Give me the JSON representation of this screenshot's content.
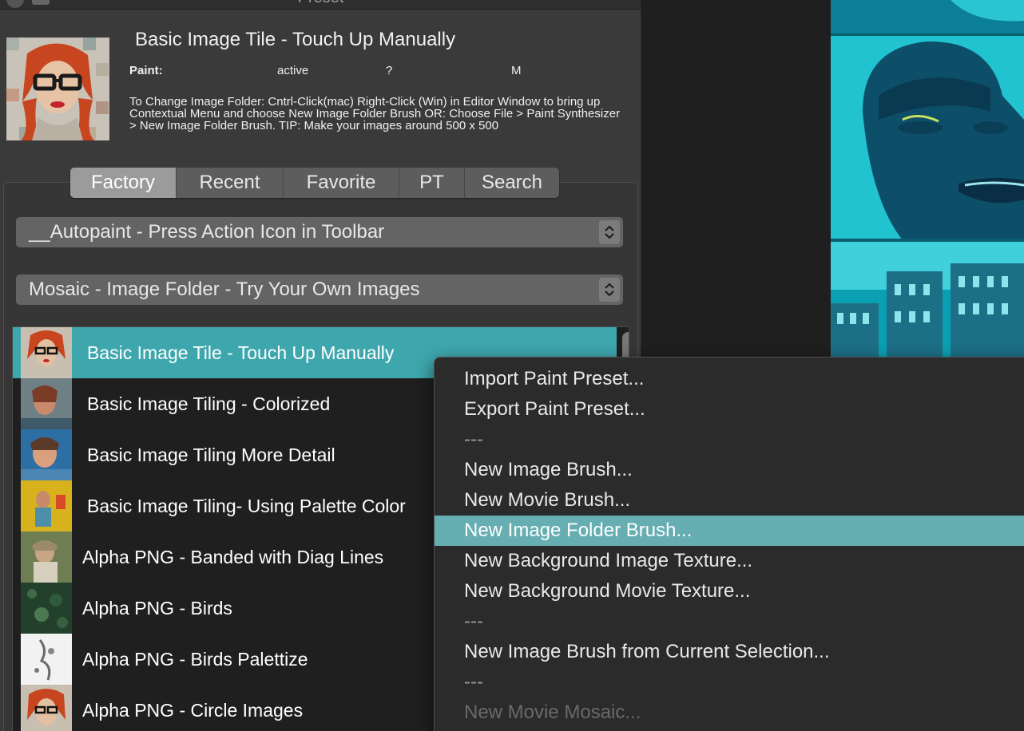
{
  "window": {
    "title": "Preset"
  },
  "header": {
    "title": "Basic Image Tile - Touch Up Manually",
    "paint_label": "Paint:",
    "paint_status": "active",
    "paint_question": "?",
    "paint_mode": "M",
    "description": "To Change Image Folder: Cntrl-Click(mac) Right-Click (Win) in Editor Window to bring up Contextual Menu and choose New Image Folder Brush OR: Choose File > Paint Synthesizer > New Image Folder Brush.  TIP: Make your images around 500 x 500"
  },
  "tabs": [
    {
      "label": "Factory",
      "selected": true
    },
    {
      "label": "Recent",
      "selected": false
    },
    {
      "label": "Favorite",
      "selected": false
    },
    {
      "label": "PT",
      "selected": false
    },
    {
      "label": "Search",
      "selected": false
    }
  ],
  "selects": {
    "category": "__Autopaint - Press Action Icon in Toolbar",
    "preset_group": "Mosaic - Image Folder - Try Your Own Images"
  },
  "preset_list": [
    {
      "label": "Basic Image Tile - Touch Up Manually",
      "selected": true
    },
    {
      "label": "Basic Image Tiling - Colorized",
      "selected": false
    },
    {
      "label": "Basic Image Tiling More Detail",
      "selected": false
    },
    {
      "label": "Basic Image Tiling- Using Palette Color",
      "selected": false
    },
    {
      "label": "Alpha PNG - Banded with Diag Lines",
      "selected": false
    },
    {
      "label": "Alpha PNG - Birds",
      "selected": false
    },
    {
      "label": "Alpha PNG - Birds Palettize",
      "selected": false
    },
    {
      "label": "Alpha PNG - Circle Images",
      "selected": false
    }
  ],
  "context_menu": {
    "items": [
      {
        "label": "Import Paint Preset...",
        "state": "normal"
      },
      {
        "label": "Export Paint Preset...",
        "state": "normal"
      },
      {
        "label": "---",
        "state": "separator"
      },
      {
        "label": "New Image Brush...",
        "state": "normal"
      },
      {
        "label": "New Movie Brush...",
        "state": "normal"
      },
      {
        "label": "New Image Folder Brush...",
        "state": "highlighted"
      },
      {
        "label": "New Background Image Texture...",
        "state": "normal"
      },
      {
        "label": "New Background Movie Texture...",
        "state": "normal"
      },
      {
        "label": "---",
        "state": "separator"
      },
      {
        "label": "New Image Brush from Current Selection...",
        "state": "normal"
      },
      {
        "label": "---",
        "state": "separator"
      },
      {
        "label": "New Movie Mosaic...",
        "state": "disabled"
      }
    ]
  },
  "colors": {
    "panel_bg": "#3a3a3a",
    "list_selection": "#3ea7ad",
    "menu_highlight": "#66aeb1",
    "canvas_cyan": "#0d8fa3"
  },
  "icons": [
    "up-down-chevron-icon",
    "window-close-icon"
  ]
}
